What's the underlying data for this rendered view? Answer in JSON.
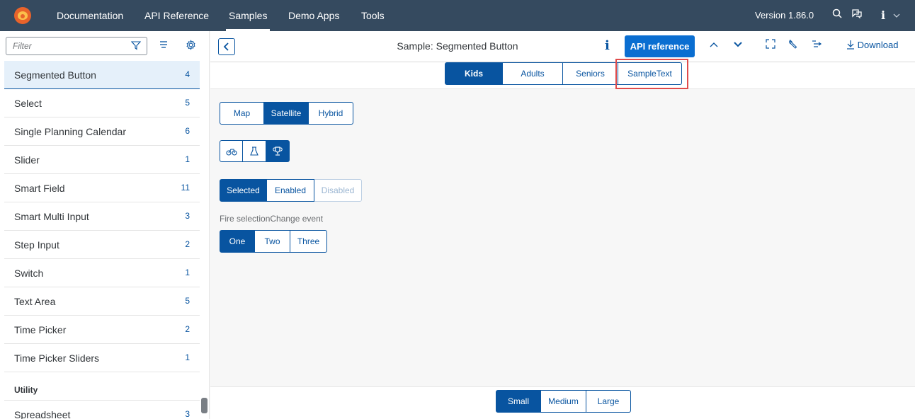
{
  "shell": {
    "nav": [
      "Documentation",
      "API Reference",
      "Samples",
      "Demo Apps",
      "Tools"
    ],
    "active_nav": "Samples",
    "version": "Version 1.86.0",
    "info_label": "i"
  },
  "sidebar": {
    "filter_placeholder": "Filter",
    "items": [
      {
        "label": "Segmented Button",
        "count": "4"
      },
      {
        "label": "Select",
        "count": "5"
      },
      {
        "label": "Single Planning Calendar",
        "count": "6"
      },
      {
        "label": "Slider",
        "count": "1"
      },
      {
        "label": "Smart Field",
        "count": "11"
      },
      {
        "label": "Smart Multi Input",
        "count": "3"
      },
      {
        "label": "Step Input",
        "count": "2"
      },
      {
        "label": "Switch",
        "count": "1"
      },
      {
        "label": "Text Area",
        "count": "5"
      },
      {
        "label": "Time Picker",
        "count": "2"
      },
      {
        "label": "Time Picker Sliders",
        "count": "1"
      }
    ],
    "group_header": "Utility",
    "group_items": [
      {
        "label": "Spreadsheet",
        "count": "3"
      }
    ]
  },
  "sample_header": {
    "title": "Sample: Segmented Button",
    "info": "i",
    "api_reference": "API reference",
    "download": "Download"
  },
  "segments": {
    "audience": [
      "Kids",
      "Adults",
      "Seniors",
      "SampleText"
    ],
    "map": [
      "Map",
      "Satellite",
      "Hybrid"
    ],
    "state": [
      "Selected",
      "Enabled",
      "Disabled"
    ],
    "fire_label": "Fire selectionChange event",
    "counts": [
      "One",
      "Two",
      "Three"
    ],
    "size": [
      "Small",
      "Medium",
      "Large"
    ]
  },
  "colors": {
    "shell": "#354a5f",
    "accent": "#0854a0",
    "api_button": "#0a6ed1",
    "highlight": "#e04b4b"
  }
}
